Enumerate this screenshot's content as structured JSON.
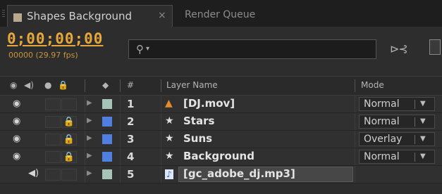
{
  "tabs": {
    "active": {
      "title": "Shapes Background",
      "close": "×",
      "swatch_color": "#b8a98e"
    },
    "inactive": {
      "title": "Render Queue"
    }
  },
  "controls": {
    "timecode": "0;00;00;00",
    "fps": "00000 (29.97 fps)",
    "search": {
      "icon": "search-icon",
      "placeholder": "",
      "caret": "▾"
    }
  },
  "header": {
    "eye": "◉",
    "speaker": "◀)",
    "solo": "●",
    "lock": "🔒",
    "label": "◆",
    "number": "#",
    "layer_name": "Layer Name",
    "mode": "Mode"
  },
  "layers": [
    {
      "number": "1",
      "name": "[DJ.mov]",
      "type": "cone-footage-icon",
      "type_glyph": "▲",
      "label_color": "#a7c4b8",
      "video": true,
      "audio": false,
      "locked": false,
      "mode": "Normal"
    },
    {
      "number": "2",
      "name": "Stars",
      "type": "shape-layer-icon",
      "type_glyph": "★",
      "label_color": "#4f7fe0",
      "video": true,
      "audio": false,
      "locked": true,
      "mode": "Normal"
    },
    {
      "number": "3",
      "name": "Suns",
      "type": "shape-layer-icon",
      "type_glyph": "★",
      "label_color": "#4f7fe0",
      "video": true,
      "audio": false,
      "locked": true,
      "mode": "Overlay"
    },
    {
      "number": "4",
      "name": "Background",
      "type": "shape-layer-icon",
      "type_glyph": "★",
      "label_color": "#4f7fe0",
      "video": true,
      "audio": false,
      "locked": true,
      "mode": "Normal"
    },
    {
      "number": "5",
      "name": "[gc_adobe_dj.mp3]",
      "type": "audio-file-icon",
      "type_glyph": "♪",
      "label_color": "#a7c4b8",
      "video": false,
      "audio": true,
      "locked": false,
      "mode": ""
    }
  ]
}
